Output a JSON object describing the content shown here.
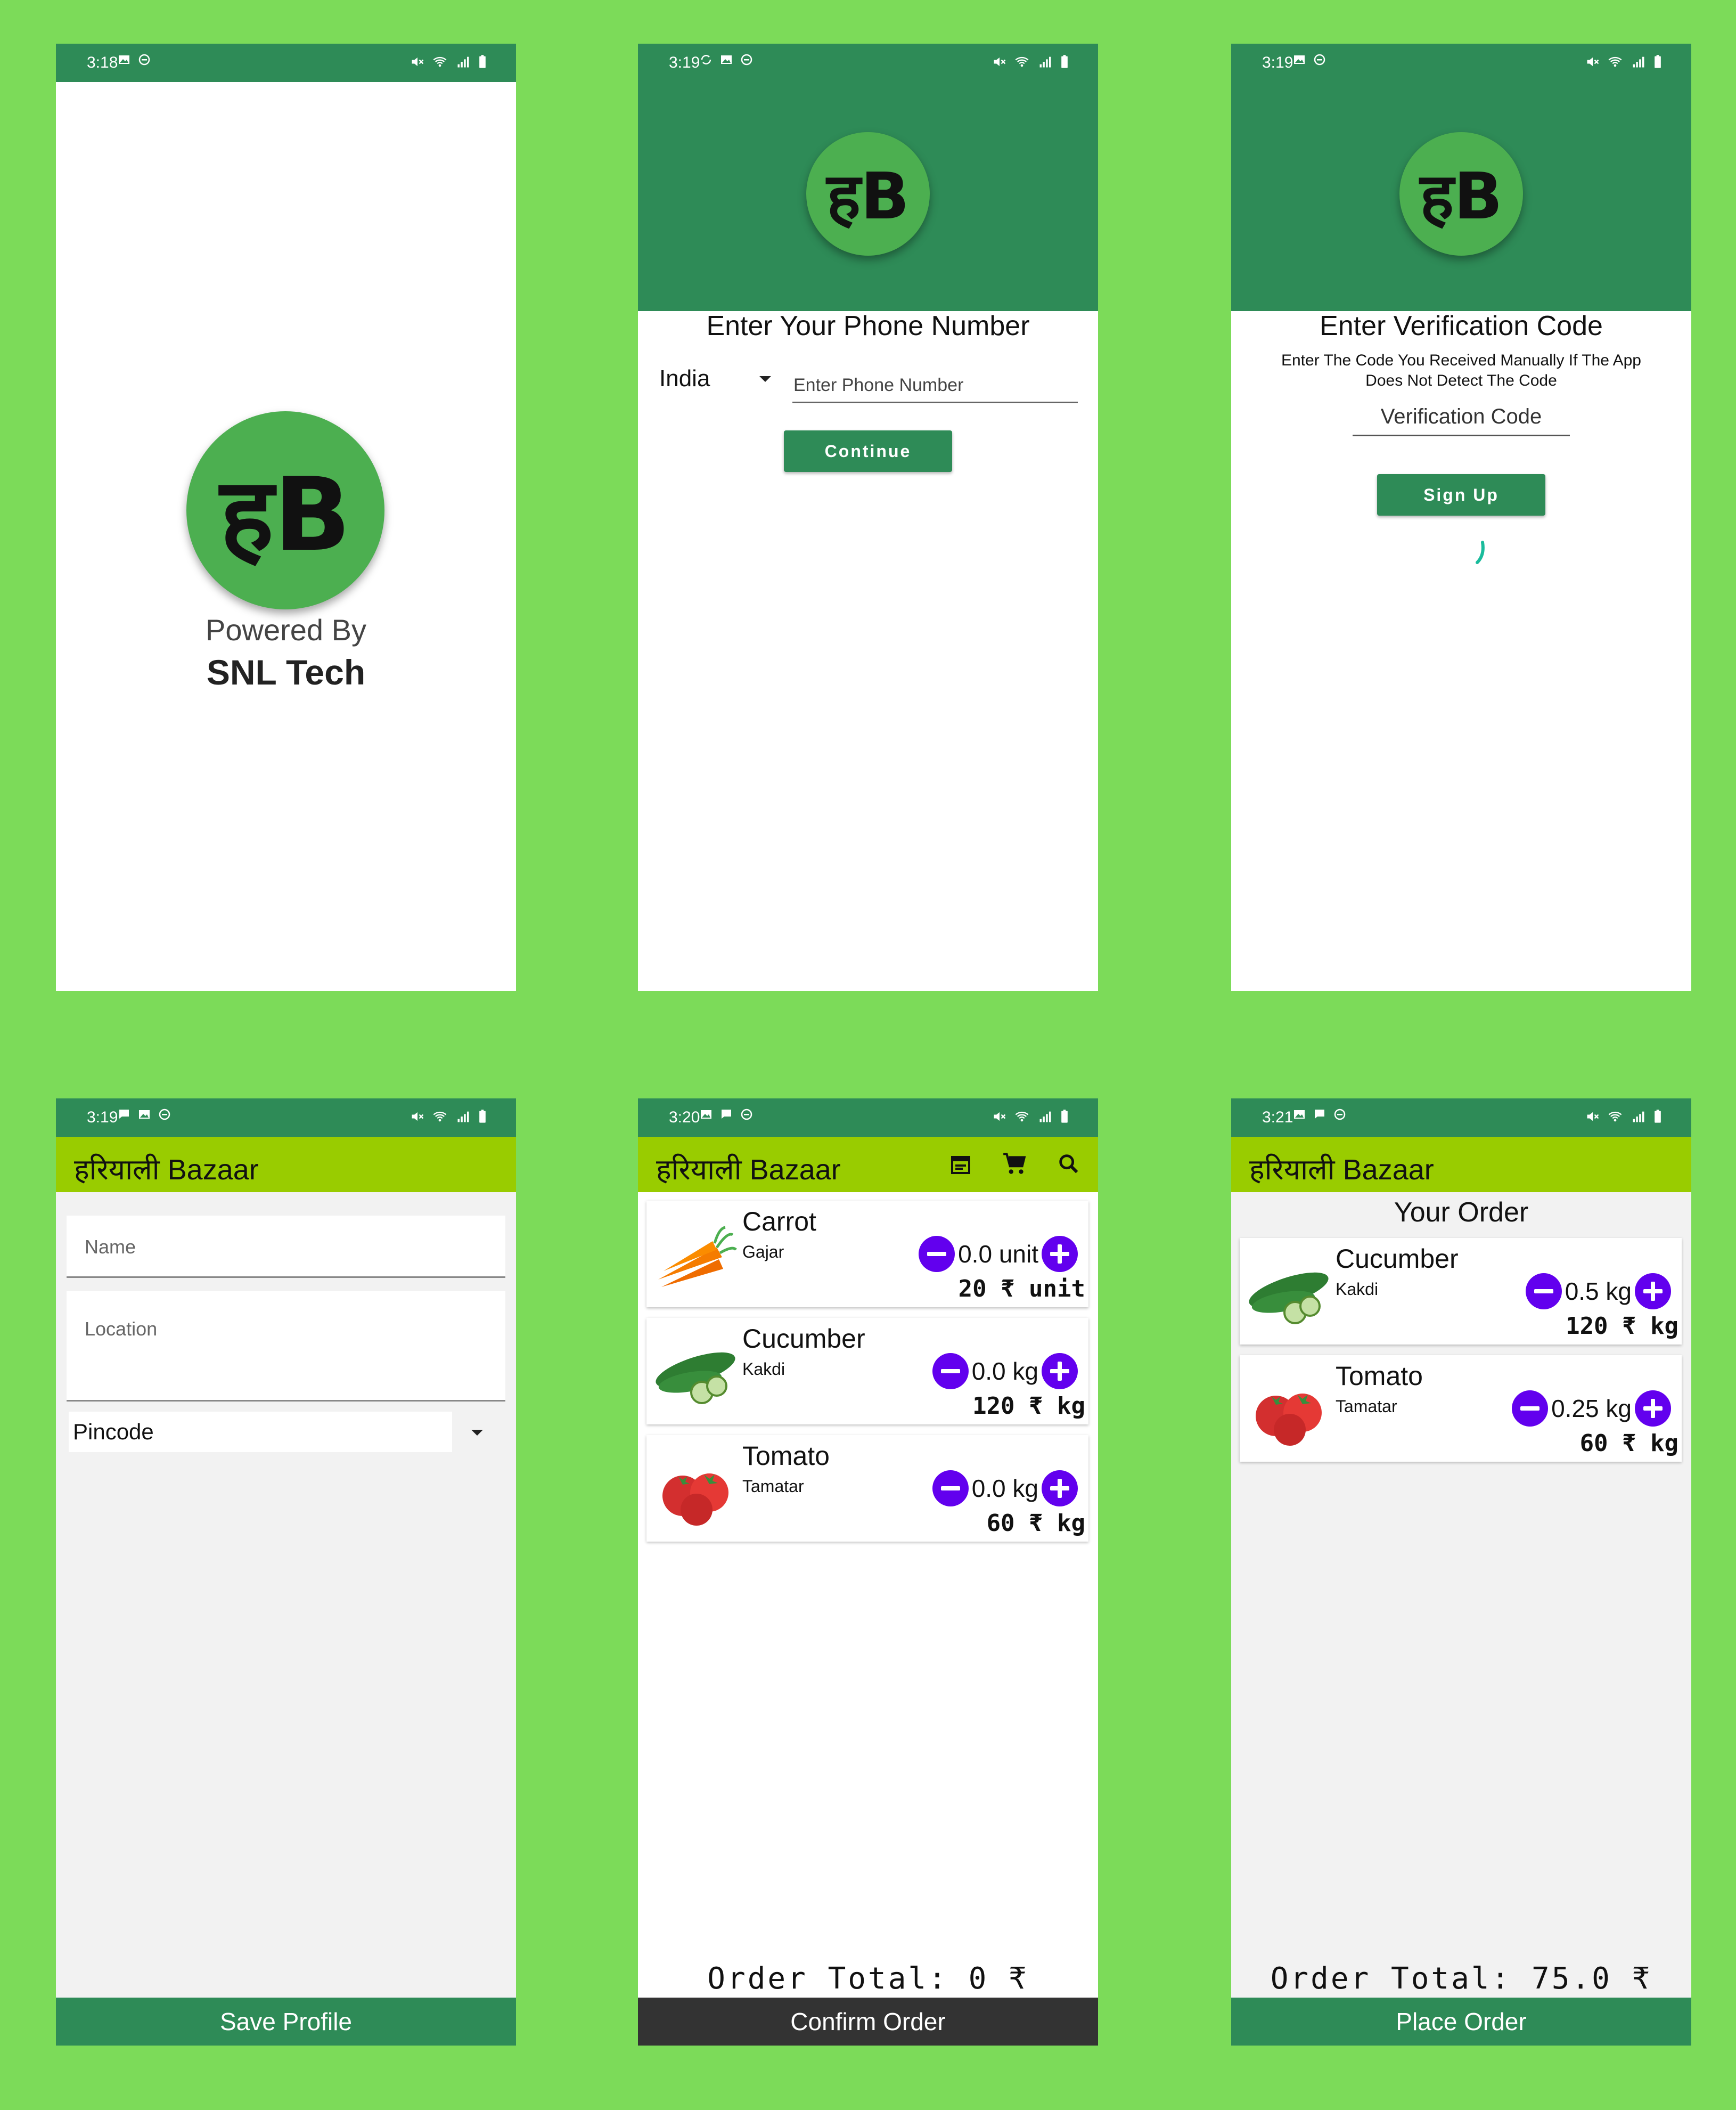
{
  "colors": {
    "background": "#7cdb59",
    "primary": "#2e8b57",
    "appbar": "#99cc00",
    "accent": "#6200ee",
    "dark": "#333333"
  },
  "logo_text": "हB",
  "splash": {
    "time": "3:18",
    "powered_by": "Powered By",
    "company": "SNL Tech"
  },
  "phone_screen": {
    "time": "3:19",
    "heading": "Enter Your Phone Number",
    "country": "India",
    "phone_placeholder": "Enter Phone Number",
    "continue_label": "Continue"
  },
  "verify_screen": {
    "time": "3:19",
    "heading": "Enter Verification Code",
    "subtext_line1": "Enter The Code You Received Manually If The App",
    "subtext_line2": "Does Not Detect The Code",
    "code_placeholder": "Verification Code",
    "signup_label": "Sign Up"
  },
  "profile_screen": {
    "time": "3:19",
    "app_title": "हरियाली Bazaar",
    "name_placeholder": "Name",
    "location_placeholder": "Location",
    "pincode_label": "Pincode",
    "save_label": "Save Profile"
  },
  "shop_screen": {
    "time": "3:20",
    "app_title": "हरियाली Bazaar",
    "items": [
      {
        "name": "Carrot",
        "local": "Gajar",
        "qty": "0.0 unit",
        "price": "20 ₹ unit"
      },
      {
        "name": "Cucumber",
        "local": "Kakdi",
        "qty": "0.0 kg",
        "price": "120 ₹ kg"
      },
      {
        "name": "Tomato",
        "local": "Tamatar",
        "qty": "0.0 kg",
        "price": "60 ₹ kg"
      }
    ],
    "order_total": "Order Total: 0 ₹",
    "confirm_label": "Confirm Order"
  },
  "order_screen": {
    "time": "3:21",
    "app_title": "हरियाली Bazaar",
    "heading": "Your Order",
    "items": [
      {
        "name": "Cucumber",
        "local": "Kakdi",
        "qty": "0.5 kg",
        "price": "120 ₹ kg"
      },
      {
        "name": "Tomato",
        "local": "Tamatar",
        "qty": "0.25 kg",
        "price": "60 ₹ kg"
      }
    ],
    "order_total": "Order Total: 75.0 ₹",
    "place_label": "Place Order"
  }
}
